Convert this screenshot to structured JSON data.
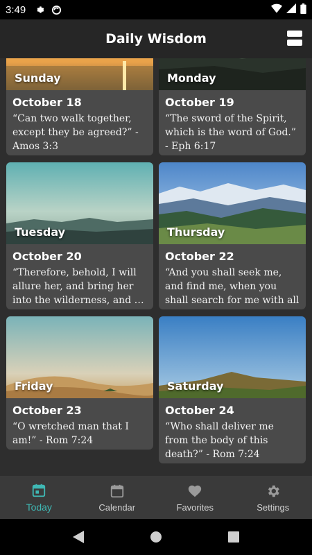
{
  "status_bar": {
    "time": "3:49"
  },
  "app_bar": {
    "title": "Daily Wisdom"
  },
  "cards": [
    {
      "day": "Sunday",
      "date": "October 18",
      "quote": "“Can two walk together, except they be agreed?” - Amos 3:3",
      "image": "sunset-sea"
    },
    {
      "day": "Monday",
      "date": "October 19",
      "quote": "“The sword of the Spirit, which is the word of God.” - Eph 6:17",
      "image": "dark-hills"
    },
    {
      "day": "Tuesday",
      "date": "October 20",
      "quote": "“Therefore, behold, I will allure her, and bring her into the wilderness, and …",
      "image": "misty-hills"
    },
    {
      "day": "Thursday",
      "date": "October 22",
      "quote": "“And you shall seek me, and find me, when you shall search for me with all you…",
      "image": "mountain-valley"
    },
    {
      "day": "Friday",
      "date": "October 23",
      "quote": "“O wretched man that I am!” - Rom 7:24",
      "image": "desert-dunes"
    },
    {
      "day": "Saturday",
      "date": "October 24",
      "quote": "“Who shall deliver me from the body of this death?” - Rom 7:24",
      "image": "green-hills"
    }
  ],
  "bottom_nav": {
    "items": [
      {
        "label": "Today",
        "icon": "calendar-today-icon",
        "active": true
      },
      {
        "label": "Calendar",
        "icon": "calendar-icon",
        "active": false
      },
      {
        "label": "Favorites",
        "icon": "heart-icon",
        "active": false
      },
      {
        "label": "Settings",
        "icon": "gear-icon",
        "active": false
      }
    ]
  },
  "colors": {
    "accent": "#3fb8b4",
    "card": "#4a4a4a",
    "background": "#2e2e2e"
  }
}
